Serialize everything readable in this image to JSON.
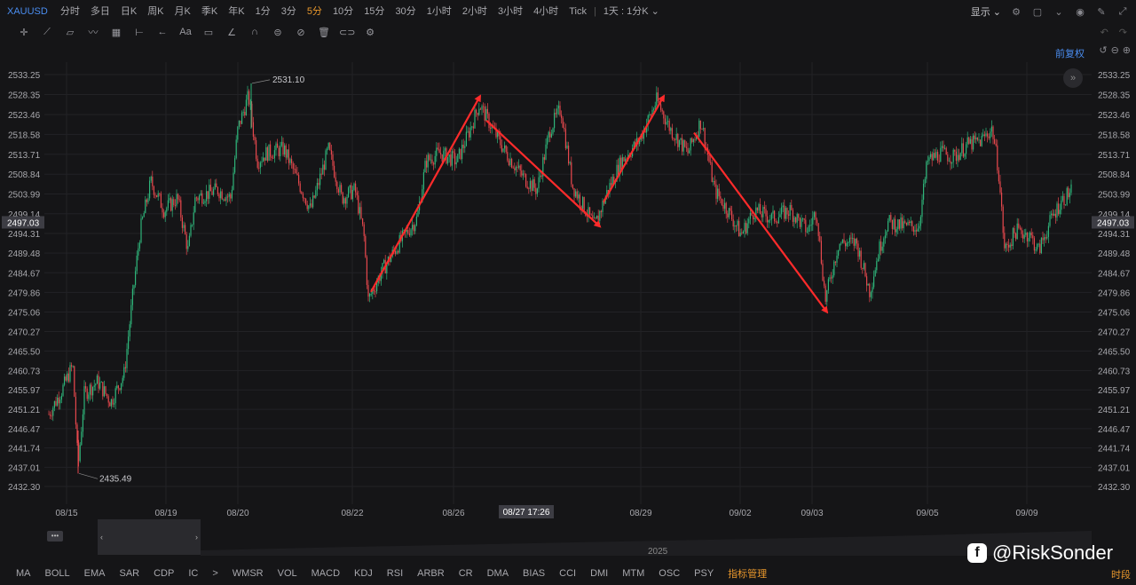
{
  "header": {
    "symbol": "XAUUSD",
    "timeframes": [
      "分时",
      "多日",
      "日K",
      "周K",
      "月K",
      "季K",
      "年K",
      "1分",
      "3分",
      "5分",
      "10分",
      "15分",
      "30分",
      "1小时",
      "2小时",
      "3小时",
      "4小时",
      "Tick"
    ],
    "active_timeframe": "5分",
    "period_select": "1天 : 1分K",
    "display_label": "显示"
  },
  "toolbar": {
    "tool_icons": [
      "crosshair-icon",
      "line-tool-icon",
      "channel-tool-icon",
      "wave-tool-icon",
      "grid-tool-icon",
      "range-tool-icon",
      "arrow-tool-icon",
      "text-tool-icon",
      "comment-tool-icon",
      "brush-tool-icon",
      "magnet-icon",
      "lock-icon",
      "hide-icon",
      "trash-icon",
      "link-icon",
      "settings-icon"
    ],
    "text_tool_label": "Aa"
  },
  "chart": {
    "restore_label": "前复权",
    "price_axis_labels": [
      "2533.25",
      "2528.35",
      "2523.46",
      "2518.58",
      "2513.71",
      "2508.84",
      "2503.99",
      "2499.14",
      "2494.31",
      "2489.48",
      "2484.67",
      "2479.86",
      "2475.06",
      "2470.27",
      "2465.50",
      "2460.73",
      "2455.97",
      "2451.21",
      "2446.47",
      "2441.74",
      "2437.01",
      "2432.30"
    ],
    "current_price": "2497.03",
    "high_label": "2531.10",
    "low_label": "2435.49",
    "date_labels": [
      "08/15",
      "08/19",
      "08/20",
      "08/22",
      "08/26",
      "08/29",
      "09/02",
      "09/03",
      "09/05",
      "09/09"
    ],
    "cursor_date": "08/27 17:26",
    "colors": {
      "up": "#2fb57a",
      "down": "#e5484d",
      "arrow": "#ff2b2b",
      "grid": "#222226"
    }
  },
  "chart_data": {
    "type": "candlestick",
    "ylim": [
      2432.3,
      2533.25
    ],
    "trend_arrows": [
      {
        "from": "08/22",
        "from_price": 2480,
        "to": "08/26",
        "to_price": 2528
      },
      {
        "from": "08/26",
        "from_price": 2522,
        "to": "08/27",
        "to_price": 2496
      },
      {
        "from": "08/28",
        "from_price": 2502,
        "to": "08/29",
        "to_price": 2528
      },
      {
        "from": "08/29",
        "from_price": 2519,
        "to": "09/03",
        "to_price": 2475
      }
    ],
    "annotated_high": 2531.1,
    "annotated_low": 2435.49
  },
  "navigator": {
    "year": "2025"
  },
  "indicators": {
    "items": [
      "MA",
      "BOLL",
      "EMA",
      "SAR",
      "CDP",
      "IC",
      ">",
      "WMSR",
      "VOL",
      "MACD",
      "KDJ",
      "RSI",
      "ARBR",
      "CR",
      "DMA",
      "BIAS",
      "CCI",
      "DMI",
      "MTM",
      "OSC",
      "PSY"
    ],
    "manage_label": "指标管理",
    "session_label": "时段"
  },
  "watermark": {
    "text": "@RiskSonder"
  }
}
